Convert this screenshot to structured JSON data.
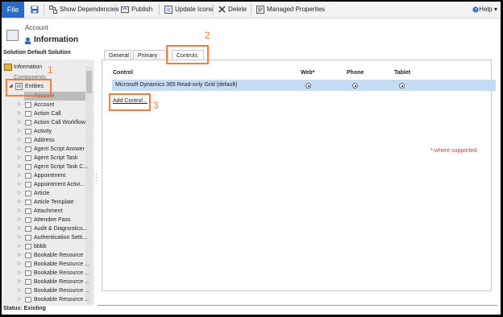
{
  "toolbar": {
    "file": "File",
    "show_dependencies": "Show Dependencies",
    "publish": "Publish",
    "update_icons": "Update Icons",
    "delete": "Delete",
    "managed_properties": "Managed Properties",
    "help": "Help"
  },
  "header": {
    "entity": "Account",
    "title": "Information",
    "solution": "Solution Default Solution"
  },
  "sidebar": {
    "information": "Information",
    "components": "Components",
    "entities": "Entities",
    "selected_item": "Account",
    "items": [
      "Account",
      "Action Call",
      "Action Call Workflow",
      "Activity",
      "Address",
      "Agent Script Answer",
      "Agent Script Task",
      "Agent Script Task C...",
      "Appointment",
      "Appointment Activi...",
      "Article",
      "Article Template",
      "Attachment",
      "Attendee Pass",
      "Audit & Diagnostics...",
      "Authentication Setti...",
      "bbbb",
      "Bookable Resource",
      "Bookable Resource ...",
      "Bookable Resource ...",
      "Bookable Resource ...",
      "Bookable Resource ...",
      "Bookable Resource ..."
    ]
  },
  "tabs": [
    "General",
    "Primary Field",
    "Controls"
  ],
  "controls": {
    "headers": {
      "control": "Control",
      "web": "Web*",
      "phone": "Phone",
      "tablet": "Tablet"
    },
    "row": "Microsoft Dynamics 365 Read-only Grid (default)",
    "add_control": "Add Control...",
    "where_note": "*-where supported"
  },
  "annotations": [
    "1",
    "2",
    "3"
  ],
  "status": "Status: Existing",
  "colors": {
    "file_button": "#2b6bc7",
    "selected_row": "#c5dcf2",
    "annotation": "#ef7d3c",
    "note": "#e0322c"
  }
}
